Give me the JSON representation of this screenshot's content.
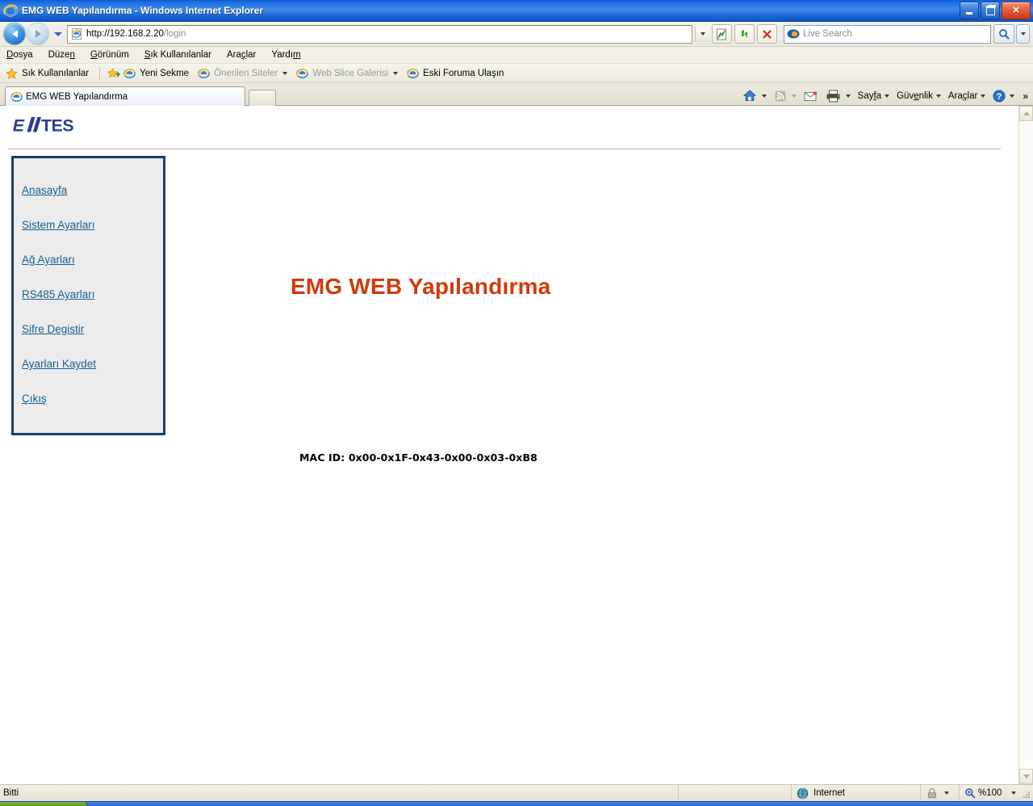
{
  "window": {
    "title": "EMG WEB Yapılandırma - Windows Internet Explorer",
    "minimize_label": "Simge Durumuna Küçült",
    "restore_label": "Geri Yükle",
    "close_label": "Kapat"
  },
  "navbar": {
    "back_label": "Geri",
    "forward_label": "İleri",
    "history_label": "Son Sayfalar",
    "url_protocol_host": "http://192.168.2.20",
    "url_path": "/login",
    "url_full": "http://192.168.2.20/login",
    "address_dropdown_label": "Adres listesi",
    "compat_label": "Uyumluluk Görünümü",
    "refresh_label": "Yenile",
    "stop_label": "Durdur",
    "search_placeholder": "Live Search",
    "search_go_label": "Ara",
    "search_dropdown_label": "Arama sağlayıcıları"
  },
  "menubar": {
    "items": [
      {
        "label": "Dosya",
        "accel_before": "",
        "accel": "D",
        "accel_after": "osya"
      },
      {
        "label": "Düzen",
        "accel_before": "Düze",
        "accel": "n",
        "accel_after": ""
      },
      {
        "label": "Görünüm",
        "accel_before": "",
        "accel": "G",
        "accel_after": "örünüm"
      },
      {
        "label": "Sık Kullanılanlar",
        "accel_before": "",
        "accel": "S",
        "accel_after": "ık Kullanılanlar"
      },
      {
        "label": "Araçlar",
        "accel_before": "Ara",
        "accel": "ç",
        "accel_after": "lar"
      },
      {
        "label": "Yardım",
        "accel_before": "Yardı",
        "accel": "m",
        "accel_after": ""
      }
    ]
  },
  "favbar": {
    "favorites_label": "Sık Kullanılanlar",
    "items": [
      {
        "label": "Yeni Sekme",
        "icon": "ie-page-icon",
        "dim": false,
        "has_caret": false
      },
      {
        "label": "Önerilen Siteler",
        "icon": "ie-icon",
        "dim": true,
        "has_caret": true
      },
      {
        "label": "Web Slice Galerisi",
        "icon": "ie-icon",
        "dim": true,
        "has_caret": true
      },
      {
        "label": "Eski Foruma Ulaşın",
        "icon": "ie-icon",
        "dim": false,
        "has_caret": false
      }
    ]
  },
  "tabs": {
    "active": {
      "label": "EMG WEB Yapılandırma",
      "icon": "ie-icon"
    },
    "newtab_label": "Yeni Sekme"
  },
  "commandbar": {
    "home_label": "Giriş Sayfası",
    "feeds_label": "Beslemeleri Görüntüle",
    "mail_label": "Posta Oku",
    "print_label": "Yazdır",
    "menus": [
      {
        "label": "Sayfa",
        "accel_before": "Say",
        "accel": "f",
        "accel_after": "a"
      },
      {
        "label": "Güvenlik",
        "accel_before": "Güv",
        "accel": "e",
        "accel_after": "nlik"
      },
      {
        "label": "Araçlar",
        "accel_before": "Ara",
        "accel": "ç",
        "accel_after": "lar"
      }
    ],
    "help_label": "Yardım",
    "overflow_label": "»"
  },
  "content": {
    "brand": "ENTES",
    "sidebar_items": [
      {
        "label": "Anasayfa",
        "name": "anasayfa"
      },
      {
        "label": "Sistem Ayarları",
        "name": "sistem-ayarlari"
      },
      {
        "label": "Ağ Ayarları",
        "name": "ag-ayarlari"
      },
      {
        "label": "RS485 Ayarları",
        "name": "rs485-ayarlari"
      },
      {
        "label": "Sifre Degistir",
        "name": "sifre-degistir"
      },
      {
        "label": "Ayarları Kaydet",
        "name": "ayarlari-kaydet"
      },
      {
        "label": "Çıkış",
        "name": "cikis"
      }
    ],
    "heading": "EMG WEB Yapılandırma",
    "mac_id": "MAC ID: 0x00-0x1F-0x43-0x00-0x03-0xB8",
    "link_color": "#1a5f8f",
    "heading_color": "#d23a0c",
    "sidebar_border_color": "#1b3d6e",
    "sidebar_bg_color": "#ececec"
  },
  "statusbar": {
    "status": "Bitti",
    "zone": "Internet",
    "protected_mode_label": "Korumalı Mod",
    "zoom": "%100",
    "zoom_dropdown_label": "Yakınlaştırma düzeyi"
  },
  "scrollbar": {
    "up_label": "Yukarı kaydır",
    "down_label": "Aşağı kaydır"
  }
}
